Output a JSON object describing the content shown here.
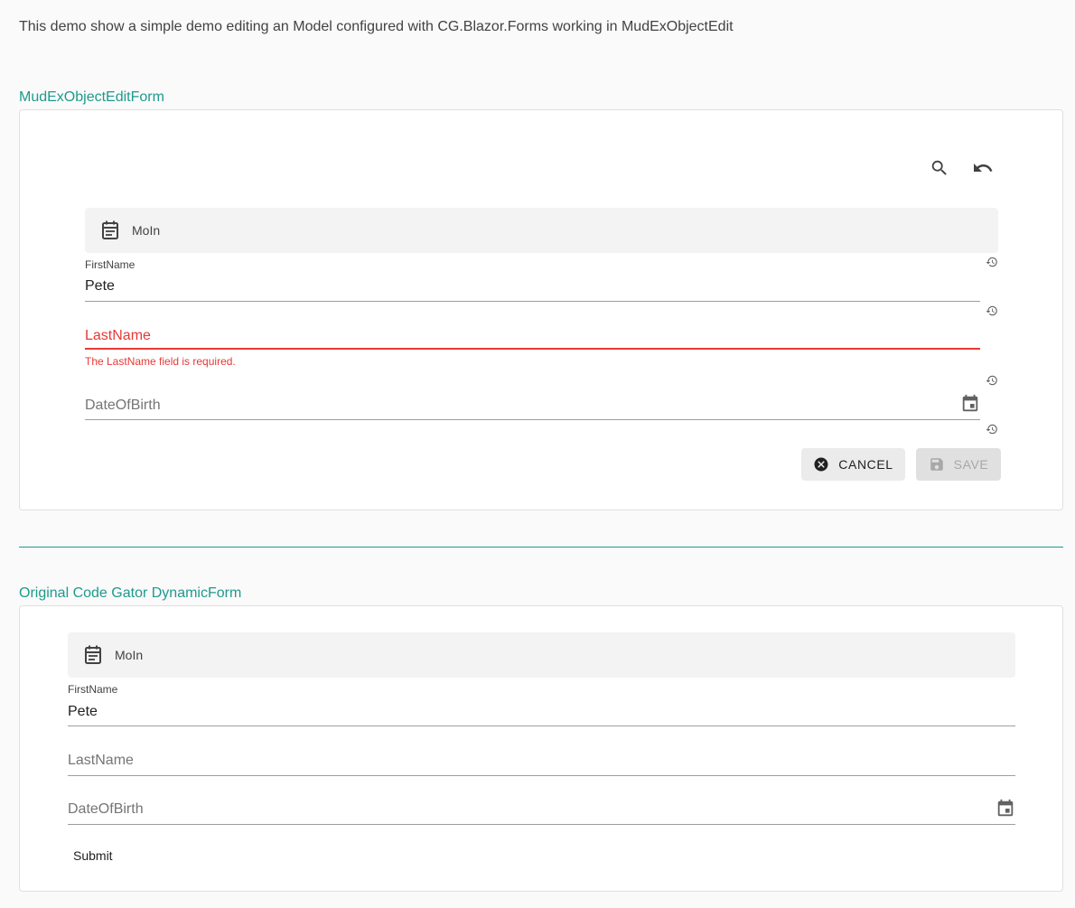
{
  "intro_text": "This demo show a simple demo editing an Model configured with CG.Blazor.Forms working in MudExObjectEdit",
  "section1": {
    "title": "MudExObjectEditForm",
    "toolbar": {
      "search_icon": "search-icon",
      "undo_icon": "undo-icon"
    },
    "group": {
      "label": "MoIn",
      "icon": "calendar-list-icon"
    },
    "fields": {
      "firstname": {
        "label": "FirstName",
        "value": "Pete"
      },
      "lastname": {
        "label": "LastName",
        "error": "The LastName field is required."
      },
      "dateofbirth": {
        "label": "DateOfBirth"
      }
    },
    "buttons": {
      "cancel": "CANCEL",
      "save": "SAVE"
    }
  },
  "section2": {
    "title": "Original Code Gator DynamicForm",
    "group": {
      "label": "MoIn",
      "icon": "calendar-list-icon"
    },
    "fields": {
      "firstname": {
        "label": "FirstName",
        "value": "Pete"
      },
      "lastname": {
        "label": "LastName"
      },
      "dateofbirth": {
        "label": "DateOfBirth"
      }
    },
    "submit": "Submit"
  },
  "colors": {
    "accent": "#1e9a8c",
    "error": "#e53935"
  }
}
